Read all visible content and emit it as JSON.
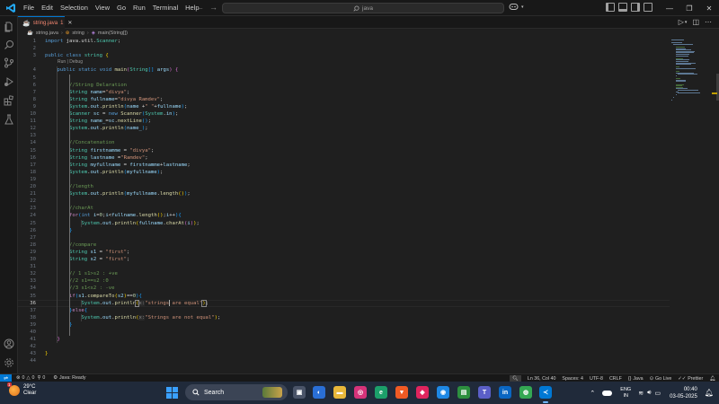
{
  "titlebar": {
    "menu": [
      "File",
      "Edit",
      "Selection",
      "View",
      "Go",
      "Run",
      "Terminal",
      "Help"
    ],
    "search": "java",
    "back_arrow": "←",
    "forward_arrow": "→"
  },
  "tab": {
    "name": "string.java",
    "status": "1"
  },
  "breadcrumbs": {
    "file": "string.java",
    "class": "string",
    "method": "main(String[])"
  },
  "editor": {
    "codelens": "Run | Debug",
    "active_line": 36
  },
  "code_lines": [
    {
      "n": "1",
      "html": "<span class=\"kw\">import</span> <span class=\"pl\">java.util.</span><span class=\"ty\">Scanner</span><span class=\"pl\">;</span>"
    },
    {
      "n": "2",
      "html": ""
    },
    {
      "n": "3",
      "html": "<span class=\"kw\">public</span> <span class=\"kw\">class</span> <span class=\"ty\">string</span> <span class=\"br1\">{</span>"
    },
    {
      "n": "4",
      "html": "    <span class=\"kw\">public</span> <span class=\"kw\">static</span> <span class=\"kw\">void</span> <span class=\"fn\">main</span><span class=\"br2\">(</span><span class=\"ty\">String</span><span class=\"br3\">[]</span> <span class=\"var\">args</span><span class=\"br2\">)</span> <span class=\"br2\">{</span>"
    },
    {
      "n": "5",
      "html": ""
    },
    {
      "n": "6",
      "html": "        <span class=\"com\">//String Delaration</span>"
    },
    {
      "n": "7",
      "html": "        <span class=\"ty\">String</span> <span class=\"var\">name</span><span class=\"pl\">=</span><span class=\"str\">\"divya\"</span><span class=\"pl\">;</span>"
    },
    {
      "n": "8",
      "html": "        <span class=\"ty\">String</span> <span class=\"var\">fullname</span><span class=\"pl\">=</span><span class=\"str\">\"divya Ramdev\"</span><span class=\"pl\">;</span>"
    },
    {
      "n": "9",
      "html": "        <span class=\"ty\">System</span><span class=\"pl\">.</span><span class=\"var\">out</span><span class=\"pl\">.</span><span class=\"fn\">println</span><span class=\"br3\">(</span><span class=\"var\">name</span> <span class=\"pl\">+</span><span class=\"str\">\" \"</span><span class=\"pl\">+</span><span class=\"var\">fullname</span><span class=\"br3\">)</span><span class=\"pl\">;</span>"
    },
    {
      "n": "10",
      "html": "        <span class=\"ty\">Scanner</span> <span class=\"var\">sc</span> <span class=\"pl\">=</span> <span class=\"kw\">new</span> <span class=\"fn\">Scanner</span><span class=\"br3\">(</span><span class=\"ty\">System</span><span class=\"pl\">.</span><span class=\"var\">in</span><span class=\"br3\">)</span><span class=\"pl\">;</span>"
    },
    {
      "n": "11",
      "html": "        <span class=\"ty\">String</span> <span class=\"var\">name_</span><span class=\"pl\">=</span><span class=\"var\">sc</span><span class=\"pl\">.</span><span class=\"fn\">nextLine</span><span class=\"br3\">()</span><span class=\"pl\">;</span>"
    },
    {
      "n": "12",
      "html": "        <span class=\"ty\">System</span><span class=\"pl\">.</span><span class=\"var\">out</span><span class=\"pl\">.</span><span class=\"fn\">println</span><span class=\"br3\">(</span><span class=\"var\">name_</span><span class=\"br3\">)</span><span class=\"pl\">;</span>"
    },
    {
      "n": "13",
      "html": ""
    },
    {
      "n": "14",
      "html": "        <span class=\"com\">//Concatenation</span>"
    },
    {
      "n": "15",
      "html": "        <span class=\"ty\">String</span> <span class=\"var\">firstnamme</span> <span class=\"pl\">=</span> <span class=\"str\">\"divya\"</span><span class=\"pl\">;</span>"
    },
    {
      "n": "16",
      "html": "        <span class=\"ty\">String</span> <span class=\"var\">lastname</span> <span class=\"pl\">=</span><span class=\"str\">\"Ramdev\"</span><span class=\"pl\">;</span>"
    },
    {
      "n": "17",
      "html": "        <span class=\"ty\">String</span> <span class=\"var\">myfullname</span> <span class=\"pl\">=</span> <span class=\"var\">firstnamme</span><span class=\"pl\">+</span><span class=\"var\">lastname</span><span class=\"pl\">;</span>"
    },
    {
      "n": "18",
      "html": "        <span class=\"ty\">System</span><span class=\"pl\">.</span><span class=\"var\">out</span><span class=\"pl\">.</span><span class=\"fn\">println</span><span class=\"br3\">(</span><span class=\"var\">myfullname</span><span class=\"br3\">)</span><span class=\"pl\">;</span>"
    },
    {
      "n": "19",
      "html": ""
    },
    {
      "n": "20",
      "html": "        <span class=\"com\">//length</span>"
    },
    {
      "n": "21",
      "html": "        <span class=\"ty\">System</span><span class=\"pl\">.</span><span class=\"var\">out</span><span class=\"pl\">.</span><span class=\"fn\">println</span><span class=\"br3\">(</span><span class=\"var\">myfullname</span><span class=\"pl\">.</span><span class=\"fn\">length</span><span class=\"br1\">()</span><span class=\"br3\">)</span><span class=\"pl\">;</span>"
    },
    {
      "n": "22",
      "html": ""
    },
    {
      "n": "23",
      "html": "        <span class=\"com\">//charAt</span>"
    },
    {
      "n": "24",
      "html": "        <span class=\"ctl\">for</span><span class=\"br3\">(</span><span class=\"kw\">int</span> <span class=\"var\">i</span><span class=\"pl\">=</span><span class=\"num\">0</span><span class=\"pl\">;</span><span class=\"var\">i</span><span class=\"pl\">&lt;</span><span class=\"var\">fullname</span><span class=\"pl\">.</span><span class=\"fn\">length</span><span class=\"br1\">()</span><span class=\"pl\">;</span><span class=\"var\">i</span><span class=\"pl\">++</span><span class=\"br3\">)</span><span class=\"br3\">{</span>"
    },
    {
      "n": "25",
      "html": "            <span class=\"ty\">System</span><span class=\"pl\">.</span><span class=\"var\">out</span><span class=\"pl\">.</span><span class=\"fn\">println</span><span class=\"br1\">(</span><span class=\"var\">fullname</span><span class=\"pl\">.</span><span class=\"fn\">charAt</span><span class=\"br2\">(</span><span class=\"var\">i</span><span class=\"br2\">)</span><span class=\"br1\">)</span><span class=\"pl\">;</span>"
    },
    {
      "n": "26",
      "html": "        <span class=\"br3\">}</span>"
    },
    {
      "n": "27",
      "html": ""
    },
    {
      "n": "28",
      "html": "        <span class=\"com\">//compare</span>"
    },
    {
      "n": "29",
      "html": "        <span class=\"ty\">String</span> <span class=\"var\">s1</span> <span class=\"pl\">=</span> <span class=\"str\">\"first\"</span><span class=\"pl\">;</span>"
    },
    {
      "n": "30",
      "html": "        <span class=\"ty\">String</span> <span class=\"var\">s2</span> <span class=\"pl\">=</span> <span class=\"str\">\"first\"</span><span class=\"pl\">;</span>"
    },
    {
      "n": "31",
      "html": ""
    },
    {
      "n": "32",
      "html": "        <span class=\"com\">// 1 s1&gt;s2 : +ve</span>"
    },
    {
      "n": "33",
      "html": "        <span class=\"com\">//2 s1==s2 :0</span>"
    },
    {
      "n": "34",
      "html": "        <span class=\"com\">//3 s1&lt;s2 : -ve</span>"
    },
    {
      "n": "35",
      "html": "        <span class=\"ctl\">if</span><span class=\"br3\">(</span><span class=\"var\">s1</span><span class=\"pl\">.</span><span class=\"fn\">compareTo</span><span class=\"br1\">(</span><span class=\"var\">s2</span><span class=\"br1\">)</span><span class=\"pl\">==</span><span class=\"num\">0</span><span class=\"br3\">)</span><span class=\"br3\">{</span>"
    },
    {
      "n": "36",
      "html": "            <span class=\"ty\">System</span><span class=\"pl\">.</span><span class=\"var\">out</span><span class=\"pl\">.</span><span class=\"fn\">println</span><span class=\"br1 bracket-match\">(</span><span class=\"inlay\">x:</span><span class=\"str\">\"strings</span><span class=\"cursor\"></span><span class=\"str\"> are equal\"</span><span class=\"br1 bracket-match\">)</span><span class=\"pl\">;</span>"
    },
    {
      "n": "37",
      "html": "        <span class=\"br3\">}</span><span class=\"ctl\">else</span><span class=\"br3\">{</span>"
    },
    {
      "n": "38",
      "html": "            <span class=\"ty\">System</span><span class=\"pl\">.</span><span class=\"var\">out</span><span class=\"pl\">.</span><span class=\"fn\">println</span><span class=\"br1\">(</span><span class=\"inlay\">x:</span><span class=\"str\">\"Strings are not equal\"</span><span class=\"br1\">)</span><span class=\"pl\">;</span>"
    },
    {
      "n": "39",
      "html": "        <span class=\"br3\">}</span>"
    },
    {
      "n": "40",
      "html": ""
    },
    {
      "n": "41",
      "html": "    <span class=\"br2\">}</span>"
    },
    {
      "n": "42",
      "html": ""
    },
    {
      "n": "43",
      "html": "<span class=\"br1\">}</span>"
    },
    {
      "n": "44",
      "html": ""
    }
  ],
  "statusbar": {
    "errors": "0",
    "warnings": "0",
    "bell_count": "0",
    "java_status": "Java: Ready",
    "position": "Ln 36, Col 40",
    "spaces": "Spaces: 4",
    "encoding": "UTF-8",
    "eol": "CRLF",
    "language": "Java",
    "golive": "Go Live",
    "prettier": "Prettier"
  },
  "taskbar": {
    "weather_temp": "29°C",
    "weather_desc": "Clear",
    "weather_badge": "1",
    "search": "Search",
    "lang_top": "ENG",
    "lang_bottom": "IN",
    "time": "00:40",
    "date": "03-05-2025"
  },
  "colors": {
    "accent": "#0078d4",
    "editor_bg": "#1f1f1f",
    "tab_error": "#f48771"
  },
  "icons": [
    "vscode-logo-icon",
    "explorer-icon",
    "search-icon",
    "source-control-icon",
    "run-debug-icon",
    "extensions-icon",
    "testing-icon",
    "account-icon",
    "settings-icon",
    "java-file-icon",
    "run-icon",
    "split-editor-icon",
    "windows-start-icon"
  ]
}
